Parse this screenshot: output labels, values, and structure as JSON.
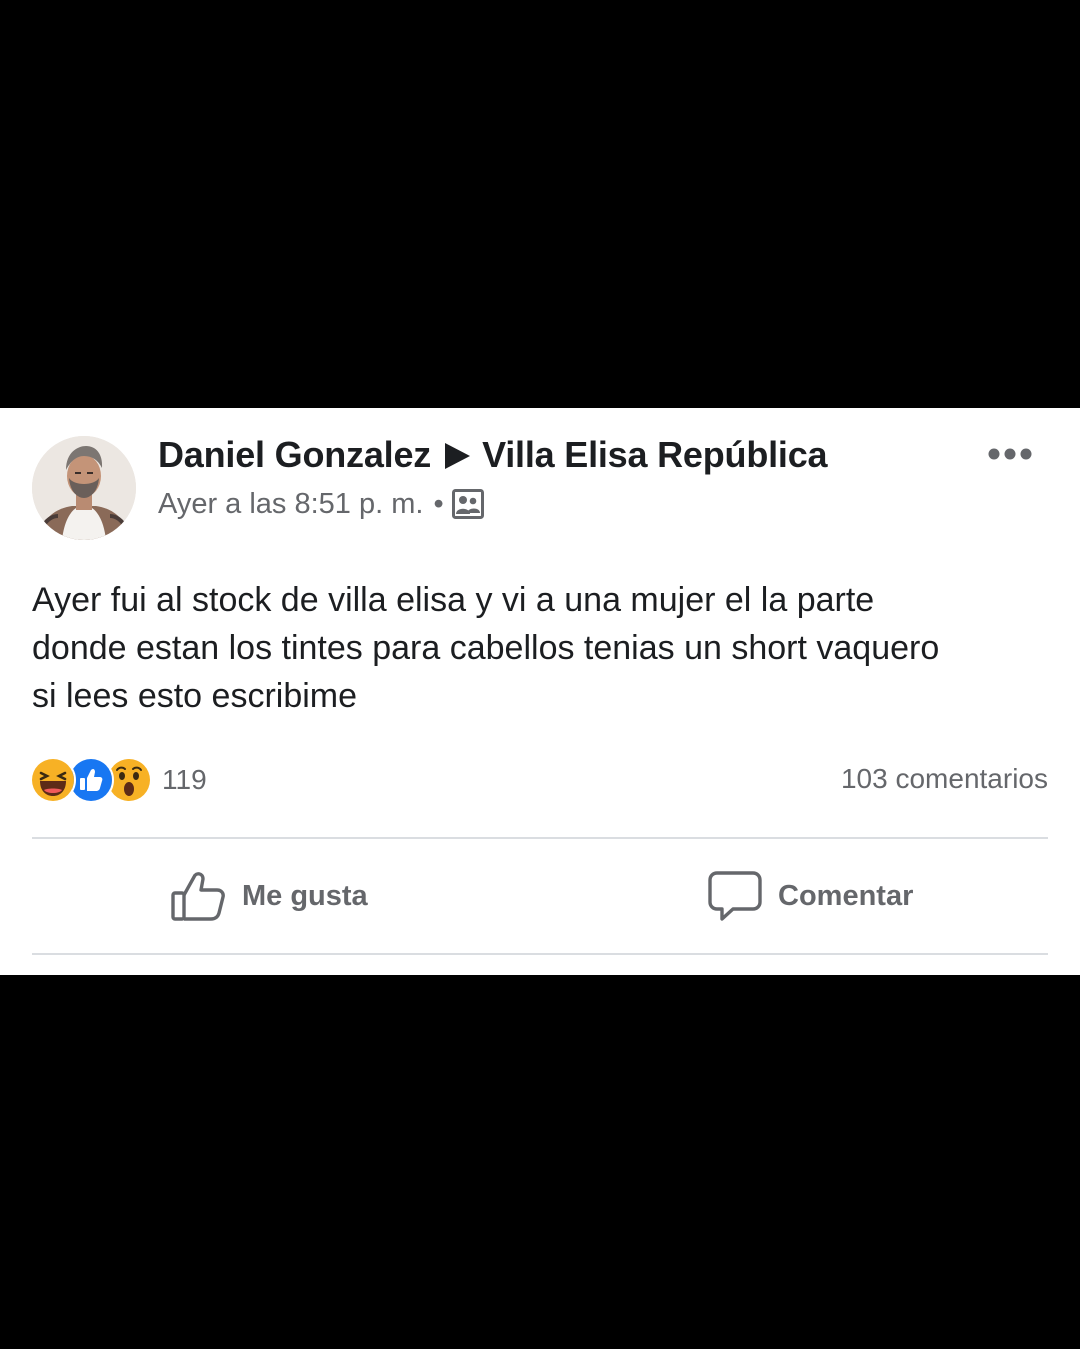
{
  "post": {
    "author": "Daniel Gonzalez",
    "group": "Villa Elisa República",
    "timestamp": "Ayer a las 8:51 p. m.",
    "separator": "•",
    "privacy_icon": "group-icon",
    "text_lines": [
      "Ayer fui al stock de villa elisa y vi a una mujer el la parte",
      "donde estan los tintes para cabellos tenias un short vaquero",
      "si lees esto escribime"
    ]
  },
  "reactions": {
    "icons": [
      "haha-icon",
      "like-reaction-icon",
      "wow-icon"
    ],
    "count": "119",
    "comments": "103 comentarios"
  },
  "actions": {
    "like_label": "Me gusta",
    "comment_label": "Comentar"
  },
  "colors": {
    "text": "#1c1e21",
    "secondary": "#65676b",
    "like_blue": "#1877f2",
    "emoji_yellow": "#f7b125",
    "divider": "#dadde1"
  }
}
